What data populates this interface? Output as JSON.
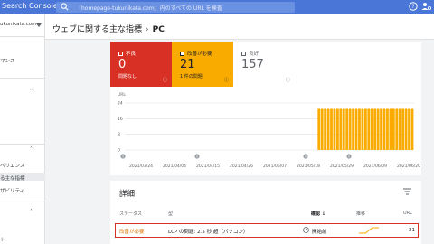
{
  "app": {
    "title": "Search Console"
  },
  "search": {
    "placeholder": "「homepage-tukunikata.com」内のすべての URL を検査"
  },
  "header": {
    "icons": [
      "help-icon",
      "user-settings-icon"
    ]
  },
  "sidebar": {
    "property": "ukunikata.com",
    "items": [
      {
        "label": "マンス"
      },
      {
        "label": "ペリエンス"
      },
      {
        "label": "る主な指標"
      },
      {
        "label": "ザビリティ"
      },
      {
        "label": "ト"
      }
    ]
  },
  "breadcrumb": {
    "parent": "ウェブに関する主な指標",
    "separator": "›",
    "current": "PC"
  },
  "stats": {
    "poor": {
      "label": "不良",
      "value": "0",
      "sub": "問題なし",
      "color": "#d93025"
    },
    "needs_improvement": {
      "label": "改善が必要",
      "value": "21",
      "sub": "1 件の問題",
      "color": "#f9ab00"
    },
    "good": {
      "label": "良好",
      "value": "157"
    }
  },
  "chart_data": {
    "type": "bar",
    "ylabel": "URL",
    "ylim": [
      0,
      24
    ],
    "yticks": [
      "24",
      "16",
      "8",
      "0"
    ],
    "xticks": [
      "2021/03/24",
      "2021/04/04",
      "2021/04/15",
      "2021/04/26",
      "2021/05/07",
      "2021/05/18",
      "2021/05/29",
      "2021/06/09",
      "2021/06/20"
    ],
    "annotations": [
      "1",
      "1",
      "1",
      "1"
    ],
    "series": [
      {
        "name": "改善が必要",
        "color": "#f9ab00",
        "values": [
          0,
          0,
          0,
          0,
          0,
          0,
          0,
          0,
          0,
          0,
          0,
          0,
          0,
          0,
          0,
          0,
          0,
          0,
          0,
          0,
          0,
          0,
          0,
          0,
          0,
          0,
          0,
          0,
          0,
          0,
          0,
          0,
          0,
          0,
          0,
          0,
          0,
          0,
          0,
          0,
          0,
          0,
          0,
          0,
          0,
          0,
          0,
          0,
          0,
          0,
          0,
          0,
          0,
          0,
          0,
          0,
          0,
          0,
          0,
          0,
          0,
          0,
          21,
          21,
          21,
          21,
          21,
          21,
          21,
          21,
          21,
          21,
          21,
          21,
          21,
          21,
          21,
          21,
          21,
          21,
          21,
          21,
          21,
          21,
          21,
          21,
          21,
          21,
          21,
          21,
          21,
          21,
          21
        ]
      }
    ]
  },
  "details": {
    "title": "詳細",
    "columns": {
      "status": "ステータス",
      "type": "型",
      "validation": "確認",
      "trend": "推移",
      "urls": "URL"
    },
    "rows": [
      {
        "status": "改善が必要",
        "type": "LCP の問題: 2.5 秒 超（パソコン）",
        "validation": "開始前",
        "trend": [
          0,
          0,
          21,
          21
        ],
        "urls": "21"
      }
    ]
  }
}
